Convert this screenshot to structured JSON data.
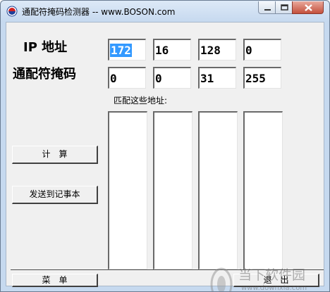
{
  "window": {
    "title": "通配符掩码检测器 -- www.BOSON.com",
    "icon": "boson-app-icon",
    "controls": [
      "minimize-icon",
      "maximize-icon",
      "close-icon"
    ]
  },
  "labels": {
    "ip": "IP 地址",
    "mask": "通配符掩码",
    "matching": "匹配这些地址:"
  },
  "ip_octets": [
    "172",
    "16",
    "128",
    "0"
  ],
  "mask_octets": [
    "0",
    "0",
    "31",
    "255"
  ],
  "match_lists": [
    [],
    [],
    [],
    []
  ],
  "buttons": {
    "calculate": "计　算",
    "send_notepad": "发送到记事本",
    "menu": "菜　单",
    "exit": "退　出"
  },
  "watermark": {
    "text": "当下软件园",
    "url": "www.downxia.com"
  }
}
